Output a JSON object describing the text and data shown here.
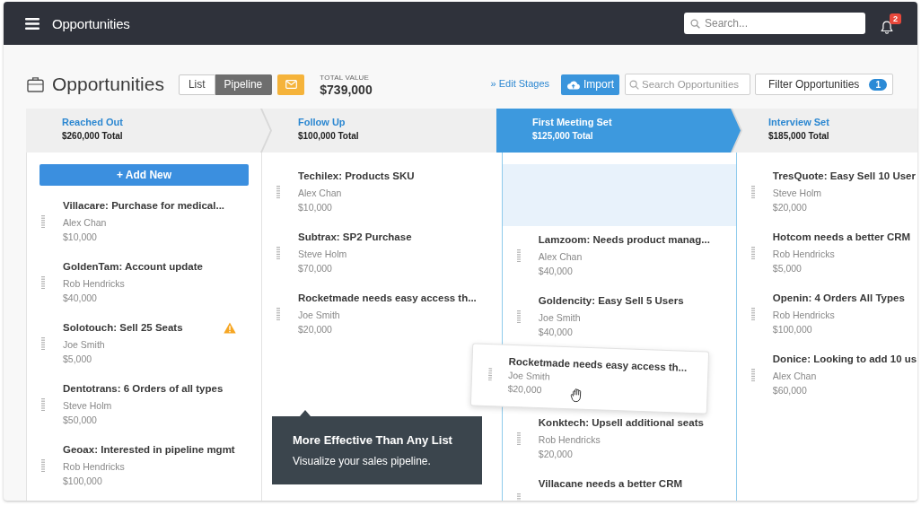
{
  "top_bar": {
    "title": "Opportunities",
    "search": {
      "placeholder": "Search..."
    },
    "notifications": {
      "count": "2"
    }
  },
  "header": {
    "title": "Opportunities",
    "view_toggle": [
      {
        "label": "List",
        "selected": false
      },
      {
        "label": "Pipeline",
        "selected": true
      }
    ],
    "total_value": {
      "label": "TOTAL VALUE",
      "value": "$739,000"
    },
    "edit_stages_link": "» Edit Stages",
    "import_button": "Import",
    "search": {
      "placeholder": "Search Opportunities"
    },
    "filter_button": {
      "label": "Filter Opportunities",
      "count": "1"
    }
  },
  "stages": [
    {
      "name": "Reached Out",
      "total": "$260,000 Total",
      "selected": false,
      "add_button": "+ Add New",
      "cards": [
        {
          "kind": "card",
          "title": "Villacare: Purchase for medical...",
          "owner": "Alex Chan",
          "amount": "$10,000",
          "warning": false
        },
        {
          "kind": "card",
          "title": "GoldenTam: Account update",
          "owner": "Rob Hendricks",
          "amount": "$40,000",
          "warning": false
        },
        {
          "kind": "card",
          "title": "Solotouch: Sell 25 Seats",
          "owner": "Joe Smith",
          "amount": "$5,000",
          "warning": true
        },
        {
          "kind": "card",
          "title": "Dentotrans: 6 Orders of all types",
          "owner": "Steve Holm",
          "amount": "$50,000",
          "warning": false
        },
        {
          "kind": "card",
          "title": "Geoax: Interested in pipeline mgmt",
          "owner": "Rob Hendricks",
          "amount": "$100,000",
          "warning": false
        }
      ]
    },
    {
      "name": "Follow Up",
      "total": "$100,000 Total",
      "selected": false,
      "cards": [
        {
          "kind": "card",
          "title": "Techilex: Products SKU",
          "owner": "Alex Chan",
          "amount": "$10,000",
          "warning": false
        },
        {
          "kind": "card",
          "title": "Subtrax: SP2 Purchase",
          "owner": "Steve Holm",
          "amount": "$70,000",
          "warning": false
        },
        {
          "kind": "card",
          "title": "Rocketmade needs easy access th...",
          "owner": "Joe Smith",
          "amount": "$20,000",
          "warning": false
        }
      ],
      "tooltip": {
        "title": "More Effective Than Any List",
        "text": "Visualize your sales pipeline."
      }
    },
    {
      "name": "First Meeting Set",
      "total": "$125,000 Total",
      "selected": true,
      "cards": [
        {
          "kind": "drop-zone"
        },
        {
          "kind": "card",
          "title": "Lamzoom: Needs product manag...",
          "owner": "Alex Chan",
          "amount": "$40,000",
          "warning": false
        },
        {
          "kind": "card",
          "title": "Goldencity: Easy Sell 5 Users",
          "owner": "Joe Smith",
          "amount": "$40,000",
          "warning": false
        },
        {
          "kind": "dragging",
          "title": "Rocketmade needs easy access th...",
          "owner": "Joe Smith",
          "amount": "$20,000",
          "warning": false
        },
        {
          "kind": "card",
          "title": "Konktech: Upsell additional seats",
          "owner": "Rob Hendricks",
          "amount": "$20,000",
          "warning": false
        },
        {
          "kind": "card",
          "title": "Villacane needs a better CRM",
          "warning": false
        }
      ]
    },
    {
      "name": "Interview Set",
      "total": "$185,000 Total",
      "selected": false,
      "cards": [
        {
          "kind": "card",
          "title": "TresQuote: Easy Sell 10 User",
          "owner": "Steve Holm",
          "amount": "$20,000",
          "warning": false
        },
        {
          "kind": "card",
          "title": "Hotcom needs a better CRM",
          "owner": "Rob Hendricks",
          "amount": "$5,000",
          "warning": false
        },
        {
          "kind": "card",
          "title": "Openin: 4 Orders All Types",
          "owner": "Rob Hendricks",
          "amount": "$100,000",
          "warning": false
        },
        {
          "kind": "card",
          "title": "Donice: Looking to add 10 us",
          "owner": "Alex Chan",
          "amount": "$60,000",
          "warning": false
        }
      ]
    }
  ]
}
